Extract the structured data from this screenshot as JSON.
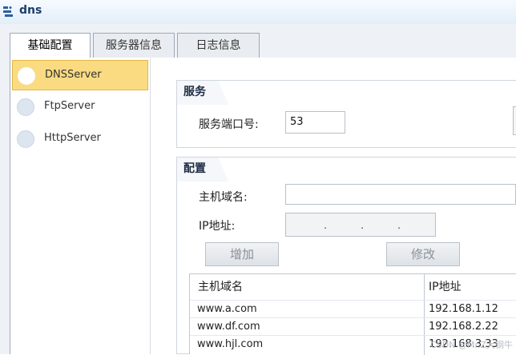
{
  "window": {
    "title": "dns",
    "icon": "dns-app-icon"
  },
  "tabs": [
    {
      "label": "基础配置",
      "active": true
    },
    {
      "label": "服务器信息",
      "active": false
    },
    {
      "label": "日志信息",
      "active": false
    }
  ],
  "devices": [
    {
      "label": "DNSServer",
      "selected": true
    },
    {
      "label": "FtpServer",
      "selected": false
    },
    {
      "label": "HttpServer",
      "selected": false
    }
  ],
  "service": {
    "section_title": "服务",
    "port_label": "服务端口号:",
    "port_value": "53"
  },
  "config": {
    "section_title": "配置",
    "hostname_label": "主机域名:",
    "hostname_value": "",
    "ip_label": "IP地址:",
    "ip_octets": [
      "",
      "",
      "",
      ""
    ],
    "add_button": "增加",
    "modify_button": "修改"
  },
  "table": {
    "columns": [
      "主机域名",
      "IP地址"
    ],
    "rows": [
      [
        "www.a.com",
        "192.168.1.12"
      ],
      [
        "www.df.com",
        "192.168.2.22"
      ],
      [
        "www.hjl.com",
        "192.168.3.33"
      ]
    ]
  },
  "watermark": "CSDN @Mr.Z大钢牛"
}
